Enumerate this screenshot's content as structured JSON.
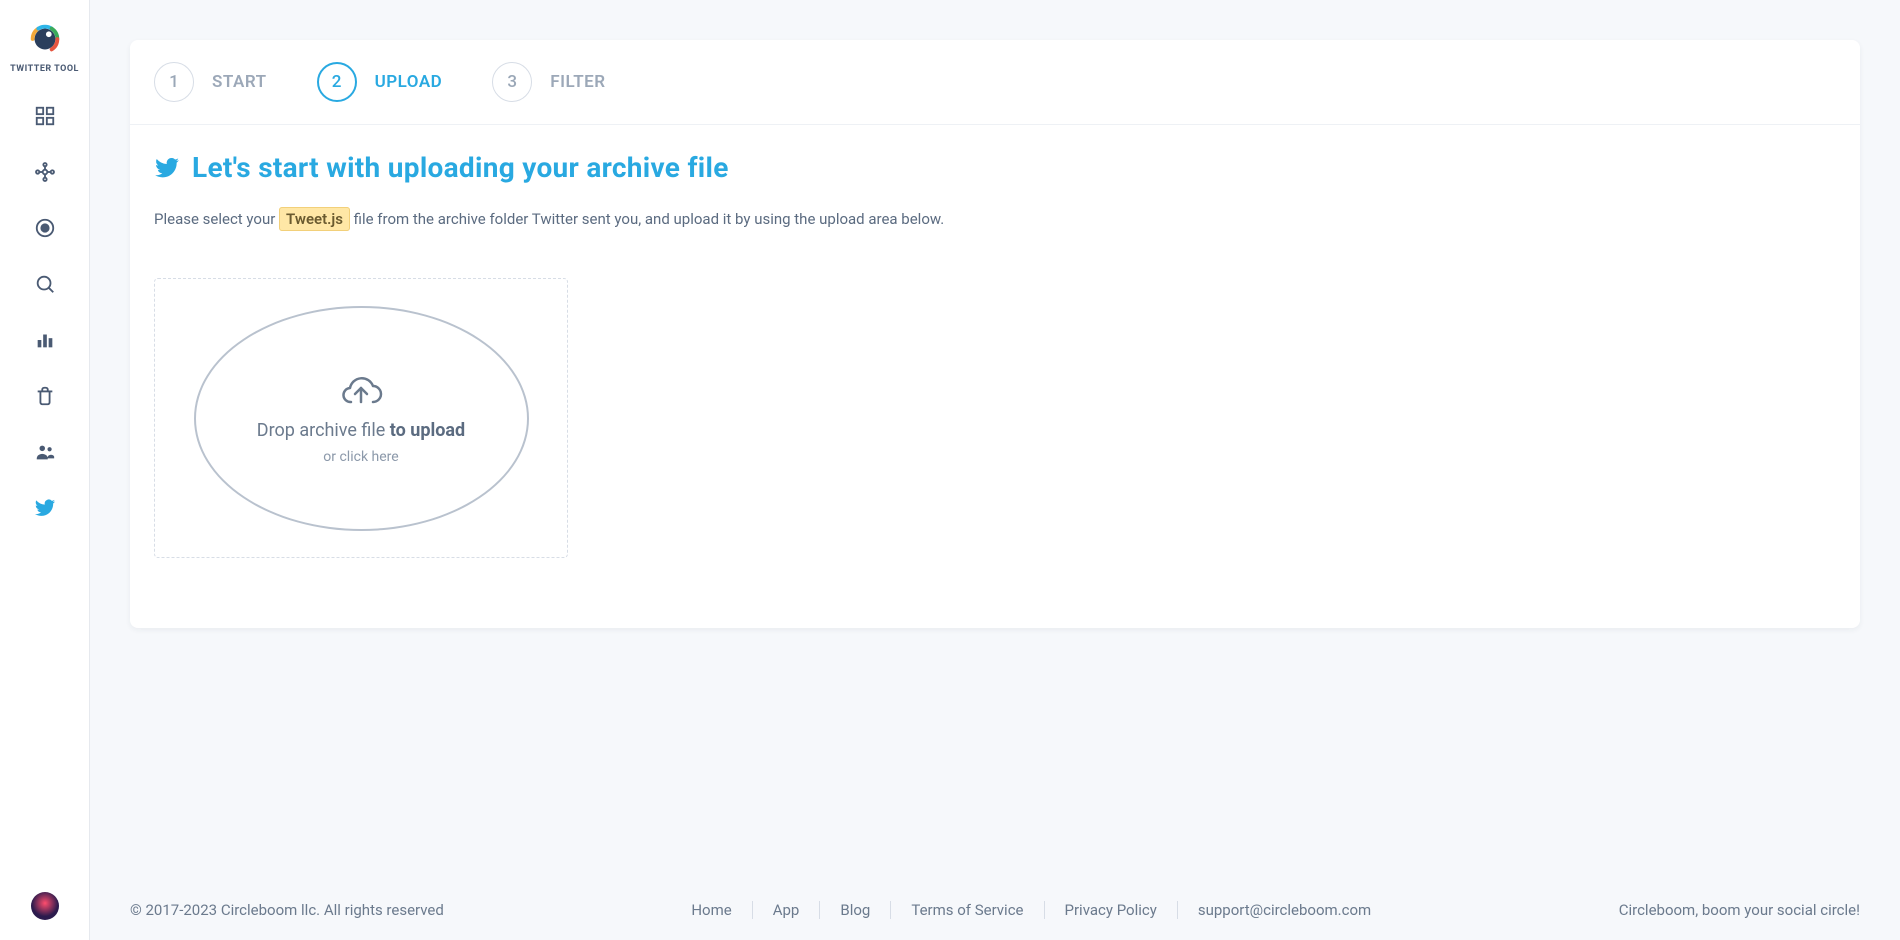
{
  "brand": {
    "label": "TWITTER TOOL"
  },
  "sidebar": {
    "items": [
      {
        "name": "dashboard-icon"
      },
      {
        "name": "graph-icon"
      },
      {
        "name": "target-icon"
      },
      {
        "name": "search-icon"
      },
      {
        "name": "bar-chart-icon"
      },
      {
        "name": "trash-icon"
      },
      {
        "name": "people-icon"
      },
      {
        "name": "twitter-icon"
      }
    ]
  },
  "stepper": {
    "steps": [
      {
        "num": "1",
        "label": "START"
      },
      {
        "num": "2",
        "label": "UPLOAD"
      },
      {
        "num": "3",
        "label": "FILTER"
      }
    ],
    "active_index": 1
  },
  "heading": "Let's start with uploading your archive file",
  "instruction": {
    "prefix": "Please select your ",
    "tag": "Tweet.js",
    "suffix": " file from the archive folder Twitter sent you, and upload it by using the upload area below."
  },
  "upload": {
    "main_prefix": "Drop archive file ",
    "main_bold": "to upload",
    "sub": "or click here"
  },
  "footer": {
    "copyright": "© 2017-2023 Circleboom llc. All rights reserved",
    "links": [
      "Home",
      "App",
      "Blog",
      "Terms of Service",
      "Privacy Policy",
      "support@circleboom.com"
    ],
    "tagline": "Circleboom, boom your social circle!"
  }
}
